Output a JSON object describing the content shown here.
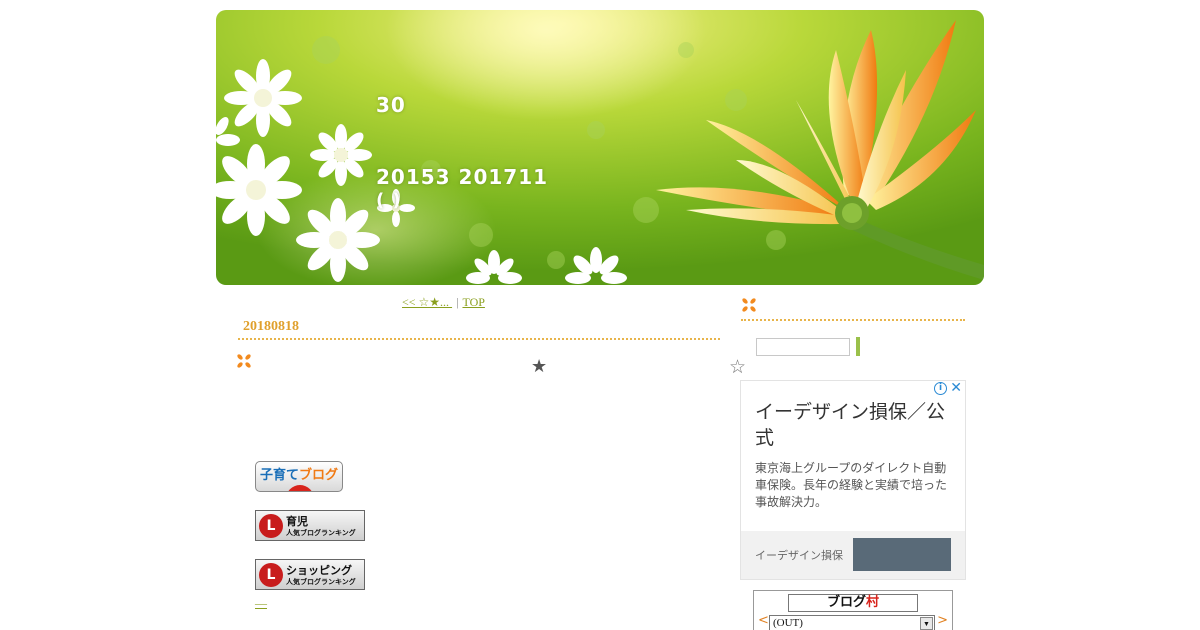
{
  "header": {
    "number": "30",
    "date_range": "20153  201711",
    "subtitle": "(  )"
  },
  "nav": {
    "prev_label": "<< ☆★...        ",
    "separator": "|",
    "top_label": "TOP"
  },
  "post": {
    "date": "20180818",
    "star_filled": "★",
    "star_empty": "☆"
  },
  "badges": {
    "kosodate_a": "子育て",
    "kosodate_b": "ブログ",
    "ikuji_title": "育児",
    "ikuji_sub": "人気ブログランキング",
    "shopping_title": "ショッピング",
    "shopping_sub": "人気ブログランキング",
    "rank_logo": "L",
    "dash_link": "—"
  },
  "ad": {
    "title": "イーデザイン損保／公式",
    "description": "東京海上グループのダイレクト自動車保険。長年の経験と実績で培った事故解決力。",
    "brand": "イーデザイン損保",
    "info_icon": "i",
    "close_icon": "✕"
  },
  "village": {
    "logo_a": "ブログ",
    "logo_b": "村",
    "prev": "<",
    "next": ">",
    "select_value": "(OUT)",
    "select_arrow": "▼"
  },
  "colors": {
    "accent_orange": "#e0a02c",
    "link_green": "#8a9f1e",
    "banner_green": "#7cb822",
    "flower_orange": "#f28a1e"
  }
}
